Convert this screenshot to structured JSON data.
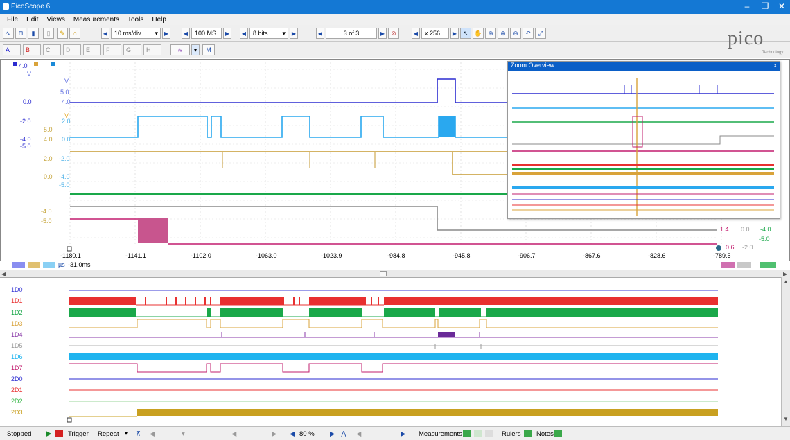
{
  "window": {
    "title": "PicoScope 6",
    "min": "–",
    "max": "❐",
    "close": "✕"
  },
  "menu": [
    "File",
    "Edit",
    "Views",
    "Measurements",
    "Tools",
    "Help"
  ],
  "toolbar": {
    "timebase": "10 ms/div",
    "samples": "100 MS",
    "resolution": "8 bits",
    "buffer": "3 of 3",
    "zoom_factor": "x 256"
  },
  "channels": [
    "A",
    "B",
    "C",
    "D",
    "E",
    "F",
    "G",
    "H"
  ],
  "logo": {
    "text": "pico",
    "sub": "Technology"
  },
  "plot": {
    "top_left_value": "4.0",
    "left_unit": "V",
    "scale_labels": [
      {
        "text": "V",
        "color": "#5b6be0"
      },
      {
        "text": "5.0",
        "color": "#5b6be0"
      },
      {
        "text": "0.0",
        "color": "#2c2cd0"
      },
      {
        "text": "4.0",
        "color": "#5b6be0"
      },
      {
        "text": "V",
        "color": "#e5a92a"
      },
      {
        "text": "-2.0",
        "color": "#2c2cd0"
      },
      {
        "text": "2.0",
        "color": "#4fb2e8"
      },
      {
        "text": "5.0",
        "color": "#c6a53b"
      },
      {
        "text": "-4.0",
        "color": "#2c2cd0"
      },
      {
        "text": "4.0",
        "color": "#c6a53b"
      },
      {
        "text": "0.0",
        "color": "#4fb2e8"
      },
      {
        "text": "-5.0",
        "color": "#2c2cd0"
      },
      {
        "text": "2.0",
        "color": "#c6a53b"
      },
      {
        "text": "-2.0",
        "color": "#4fb2e8"
      },
      {
        "text": "0.0",
        "color": "#c6a53b"
      },
      {
        "text": "-4.0",
        "color": "#4fb2e8"
      },
      {
        "text": "-5.0",
        "color": "#4fb2e8"
      },
      {
        "text": "-4.0",
        "color": "#c6a53b"
      },
      {
        "text": "-5.0",
        "color": "#c6a53b"
      }
    ],
    "right_labels": [
      "1.4",
      "0.0",
      "-4.0",
      "-5.0",
      "0.6",
      "-2.0"
    ],
    "x_ticks": [
      "-1180.1",
      "-1141.1",
      "-1102.0",
      "-1063.0",
      "-1023.9",
      "-984.8",
      "-945.8",
      "-906.7",
      "-867.6",
      "-828.6",
      "-789.5"
    ],
    "x_unit": "µs",
    "x_offset": "-31.0ms"
  },
  "zoom_overview": {
    "title": "Zoom Overview",
    "close": "x"
  },
  "digital_channels": [
    {
      "name": "1D0",
      "color": "#3a3ad6"
    },
    {
      "name": "1D1",
      "color": "#e83030"
    },
    {
      "name": "1D2",
      "color": "#1aa84a"
    },
    {
      "name": "1D3",
      "color": "#d9a33a"
    },
    {
      "name": "1D4",
      "color": "#8a3aa8"
    },
    {
      "name": "1D5",
      "color": "#9a9a9a"
    },
    {
      "name": "1D6",
      "color": "#1fb4ef"
    },
    {
      "name": "1D7",
      "color": "#c21c6e"
    },
    {
      "name": "2D0",
      "color": "#2a2ad0"
    },
    {
      "name": "2D1",
      "color": "#e83030"
    },
    {
      "name": "2D2",
      "color": "#3ab84a"
    },
    {
      "name": "2D3",
      "color": "#c9a020"
    }
  ],
  "status": {
    "state": "Stopped",
    "trigger": "Trigger",
    "mode": "Repeat",
    "zoom": "80 %",
    "measurements": "Measurements",
    "rulers": "Rulers",
    "notes": "Notes"
  }
}
